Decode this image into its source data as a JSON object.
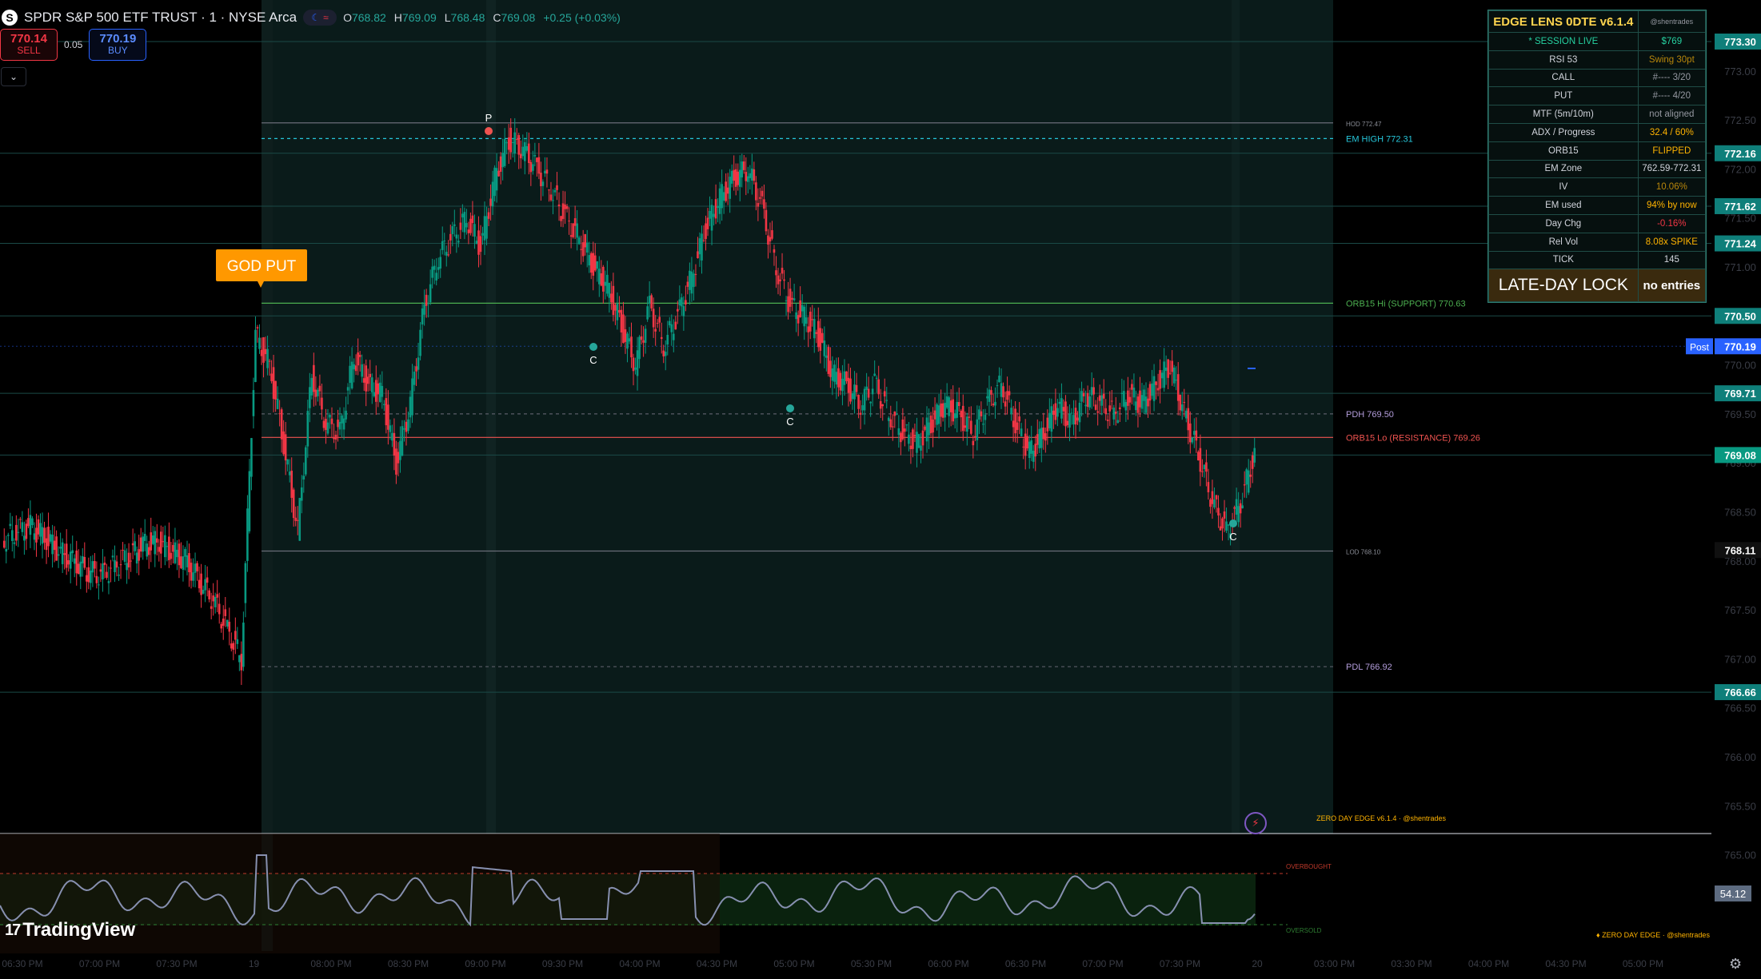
{
  "header": {
    "symbol_logo": "S",
    "title": "SPDR S&P 500 ETF TRUST · 1 · NYSE Arca",
    "mode_icons": "moon-icon wave-icon",
    "ohlc": [
      {
        "k": "O",
        "v": "768.82"
      },
      {
        "k": "H",
        "v": "769.09"
      },
      {
        "k": "L",
        "v": "768.48"
      },
      {
        "k": "C",
        "v": "769.08"
      },
      {
        "k": "",
        "v": "+0.25 (+0.03%)"
      }
    ]
  },
  "trade": {
    "sell_price": "770.14",
    "sell_label": "SELL",
    "spread": "0.05",
    "buy_price": "770.19",
    "buy_label": "BUY"
  },
  "collapse_icon": "chevron-down-icon",
  "signals": {
    "god_put": "GOD PUT",
    "p_label": "P",
    "c_label": "C"
  },
  "levels": {
    "hod": "HOD 772.47",
    "em_high": "EM HIGH 772.31",
    "orb_hi": "ORB15 Hi (SUPPORT) 770.63",
    "pdh": "PDH 769.50",
    "orb_lo": "ORB15 Lo (RESISTANCE) 769.26",
    "lod": "LOD 768.10",
    "pdl": "PDL 766.92"
  },
  "price_axis": {
    "ticks": [
      "773.00",
      "772.50",
      "772.00",
      "771.50",
      "771.00",
      "770.50",
      "770.00",
      "769.50",
      "769.00",
      "768.50",
      "768.00",
      "767.50",
      "767.00",
      "766.50",
      "766.00",
      "765.50",
      "765.00"
    ],
    "badges": [
      {
        "v": "773.30",
        "c": "#0f7f7a"
      },
      {
        "v": "772.16",
        "c": "#0f7f7a"
      },
      {
        "v": "771.62",
        "c": "#0f7f7a"
      },
      {
        "v": "771.24",
        "c": "#0f7f7a"
      },
      {
        "v": "770.50",
        "c": "#0f7f7a"
      },
      {
        "v": "770.19",
        "c": "#2962ff",
        "tag": "Post"
      },
      {
        "v": "769.71",
        "c": "#0f7f7a"
      },
      {
        "v": "769.08",
        "c": "#089981"
      },
      {
        "v": "768.11",
        "c": "#101010"
      },
      {
        "v": "766.66",
        "c": "#0f7f7a"
      }
    ]
  },
  "time_axis": [
    "06:30 PM",
    "07:00 PM",
    "07:30 PM",
    "19",
    "08:00 PM",
    "08:30 PM",
    "09:00 PM",
    "09:30 PM",
    "04:00 PM",
    "04:30 PM",
    "05:00 PM",
    "05:30 PM",
    "06:00 PM",
    "06:30 PM",
    "07:00 PM",
    "07:30 PM",
    "20",
    "03:00 PM",
    "03:30 PM",
    "04:00 PM",
    "04:30 PM",
    "05:00 PM"
  ],
  "panel": {
    "title": "EDGE LENS 0DTE v6.1.4",
    "handle": "@shentrades",
    "rows": [
      {
        "k": "* SESSION LIVE",
        "v": "$769",
        "kc": "#26d0a0",
        "vc": "#26d0a0"
      },
      {
        "k": "RSI  53",
        "v": "Swing  30pt",
        "kc": "#d1d4dc",
        "vc": "#b8860b"
      },
      {
        "k": "CALL",
        "v": "#---- 3/20",
        "kc": "#d1d4dc",
        "vc": "#9598a1"
      },
      {
        "k": "PUT",
        "v": "#---- 4/20",
        "kc": "#d1d4dc",
        "vc": "#9598a1"
      },
      {
        "k": "MTF (5m/10m)",
        "v": "not aligned",
        "kc": "#d1d4dc",
        "vc": "#9598a1"
      },
      {
        "k": "ADX / Progress",
        "v": "32.4 / 60%",
        "kc": "#d1d4dc",
        "vc": "#ffb300"
      },
      {
        "k": "ORB15",
        "v": "FLIPPED",
        "kc": "#d1d4dc",
        "vc": "#ffb300"
      },
      {
        "k": "EM Zone",
        "v": "762.59-772.31",
        "kc": "#d1d4dc",
        "vc": "#d1d4dc"
      },
      {
        "k": "IV",
        "v": "10.06%",
        "kc": "#d1d4dc",
        "vc": "#b8860b"
      },
      {
        "k": "EM used",
        "v": "94% by now",
        "kc": "#d1d4dc",
        "vc": "#ffb300"
      },
      {
        "k": "Day Chg",
        "v": "-0.16%",
        "kc": "#d1d4dc",
        "vc": "#f23645"
      },
      {
        "k": "Rel Vol",
        "v": "8.08x SPIKE",
        "kc": "#d1d4dc",
        "vc": "#ffb300"
      },
      {
        "k": "TICK",
        "v": "145",
        "kc": "#d1d4dc",
        "vc": "#d1d4dc"
      }
    ],
    "lock_label": "LATE-DAY LOCK",
    "lock_value": "no entries"
  },
  "watermark": "ZERO DAY EDGE v6.1.4 · @shentrades",
  "osc": {
    "value": "54.12",
    "overbought": "OVERBOUGHT",
    "oversold": "OVERSOLD",
    "watermark": "ZERO DAY EDGE · @shentrades"
  },
  "brand": "TradingView",
  "chart_data": {
    "type": "candlestick",
    "symbol": "SPY",
    "interval": "1",
    "last": 769.08,
    "series_close": [
      768.2,
      768.3,
      768.35,
      768.25,
      768.1,
      768.0,
      767.9,
      767.85,
      767.95,
      768.05,
      768.15,
      768.2,
      768.1,
      768.0,
      767.8,
      767.6,
      767.3,
      767.0,
      770.3,
      770.0,
      769.2,
      768.3,
      769.9,
      769.4,
      769.3,
      770.1,
      769.8,
      769.7,
      769.0,
      769.6,
      770.6,
      771.1,
      771.3,
      771.5,
      771.2,
      771.9,
      772.3,
      772.2,
      772.0,
      771.8,
      771.5,
      771.3,
      771.0,
      770.8,
      770.4,
      770.0,
      770.6,
      770.2,
      770.5,
      770.9,
      771.4,
      771.7,
      771.9,
      772.0,
      771.6,
      771.0,
      770.6,
      770.5,
      770.3,
      769.9,
      769.8,
      769.6,
      769.8,
      769.5,
      769.3,
      769.2,
      769.4,
      769.6,
      769.5,
      769.3,
      769.6,
      769.8,
      769.4,
      769.1,
      769.3,
      769.6,
      769.4,
      769.7,
      769.6,
      769.5,
      769.7,
      769.6,
      769.8,
      770.0,
      769.5,
      769.1,
      768.6,
      768.3,
      768.6,
      769.1
    ]
  }
}
